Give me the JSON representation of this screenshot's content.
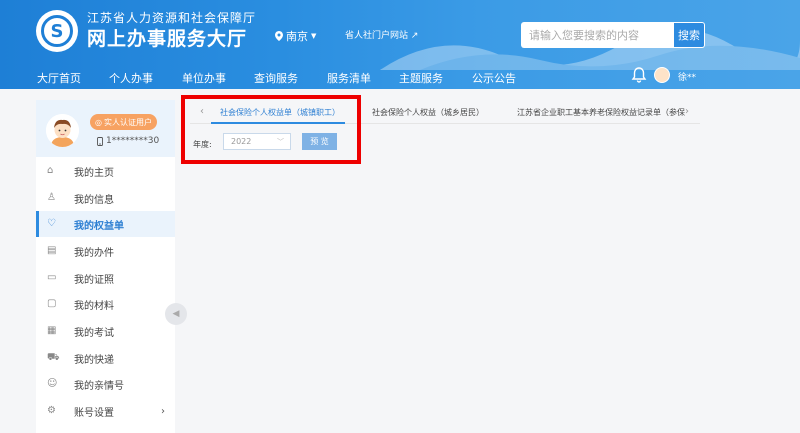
{
  "header": {
    "org_name": "江苏省人力资源和社会保障厅",
    "site_title": "网上办事服务大厅",
    "city": "南京",
    "portal_link": "省人社门户网站",
    "search_placeholder": "请输入您要搜索的内容",
    "search_button": "搜索",
    "user_name": "徐**"
  },
  "nav": [
    "大厅首页",
    "个人办事",
    "单位办事",
    "查询服务",
    "服务清单",
    "主题服务",
    "公示公告"
  ],
  "sidebar": {
    "verify_badge": "实人认证用户",
    "phone": "1********30",
    "items": [
      {
        "label": "我的主页",
        "icon": "home-icon"
      },
      {
        "label": "我的信息",
        "icon": "user-icon"
      },
      {
        "label": "我的权益单",
        "icon": "shield-icon"
      },
      {
        "label": "我的办件",
        "icon": "document-icon"
      },
      {
        "label": "我的证照",
        "icon": "card-icon"
      },
      {
        "label": "我的材料",
        "icon": "folder-icon"
      },
      {
        "label": "我的考试",
        "icon": "exam-icon"
      },
      {
        "label": "我的快递",
        "icon": "truck-icon"
      },
      {
        "label": "我的亲情号",
        "icon": "family-icon"
      },
      {
        "label": "账号设置",
        "icon": "settings-icon"
      }
    ]
  },
  "tabs": [
    "社会保险个人权益单（城镇职工）",
    "社会保险个人权益（城乡居民）",
    "江苏省企业职工基本养老保险权益记录单（参保"
  ],
  "form": {
    "year_label": "年度:",
    "year_value": "2022",
    "preview_button": "预 览"
  },
  "colors": {
    "header_blue": "#1e7fd6",
    "accent_blue": "#2d8be0",
    "badge_orange": "#f7a262",
    "highlight_red": "#ee0000"
  }
}
